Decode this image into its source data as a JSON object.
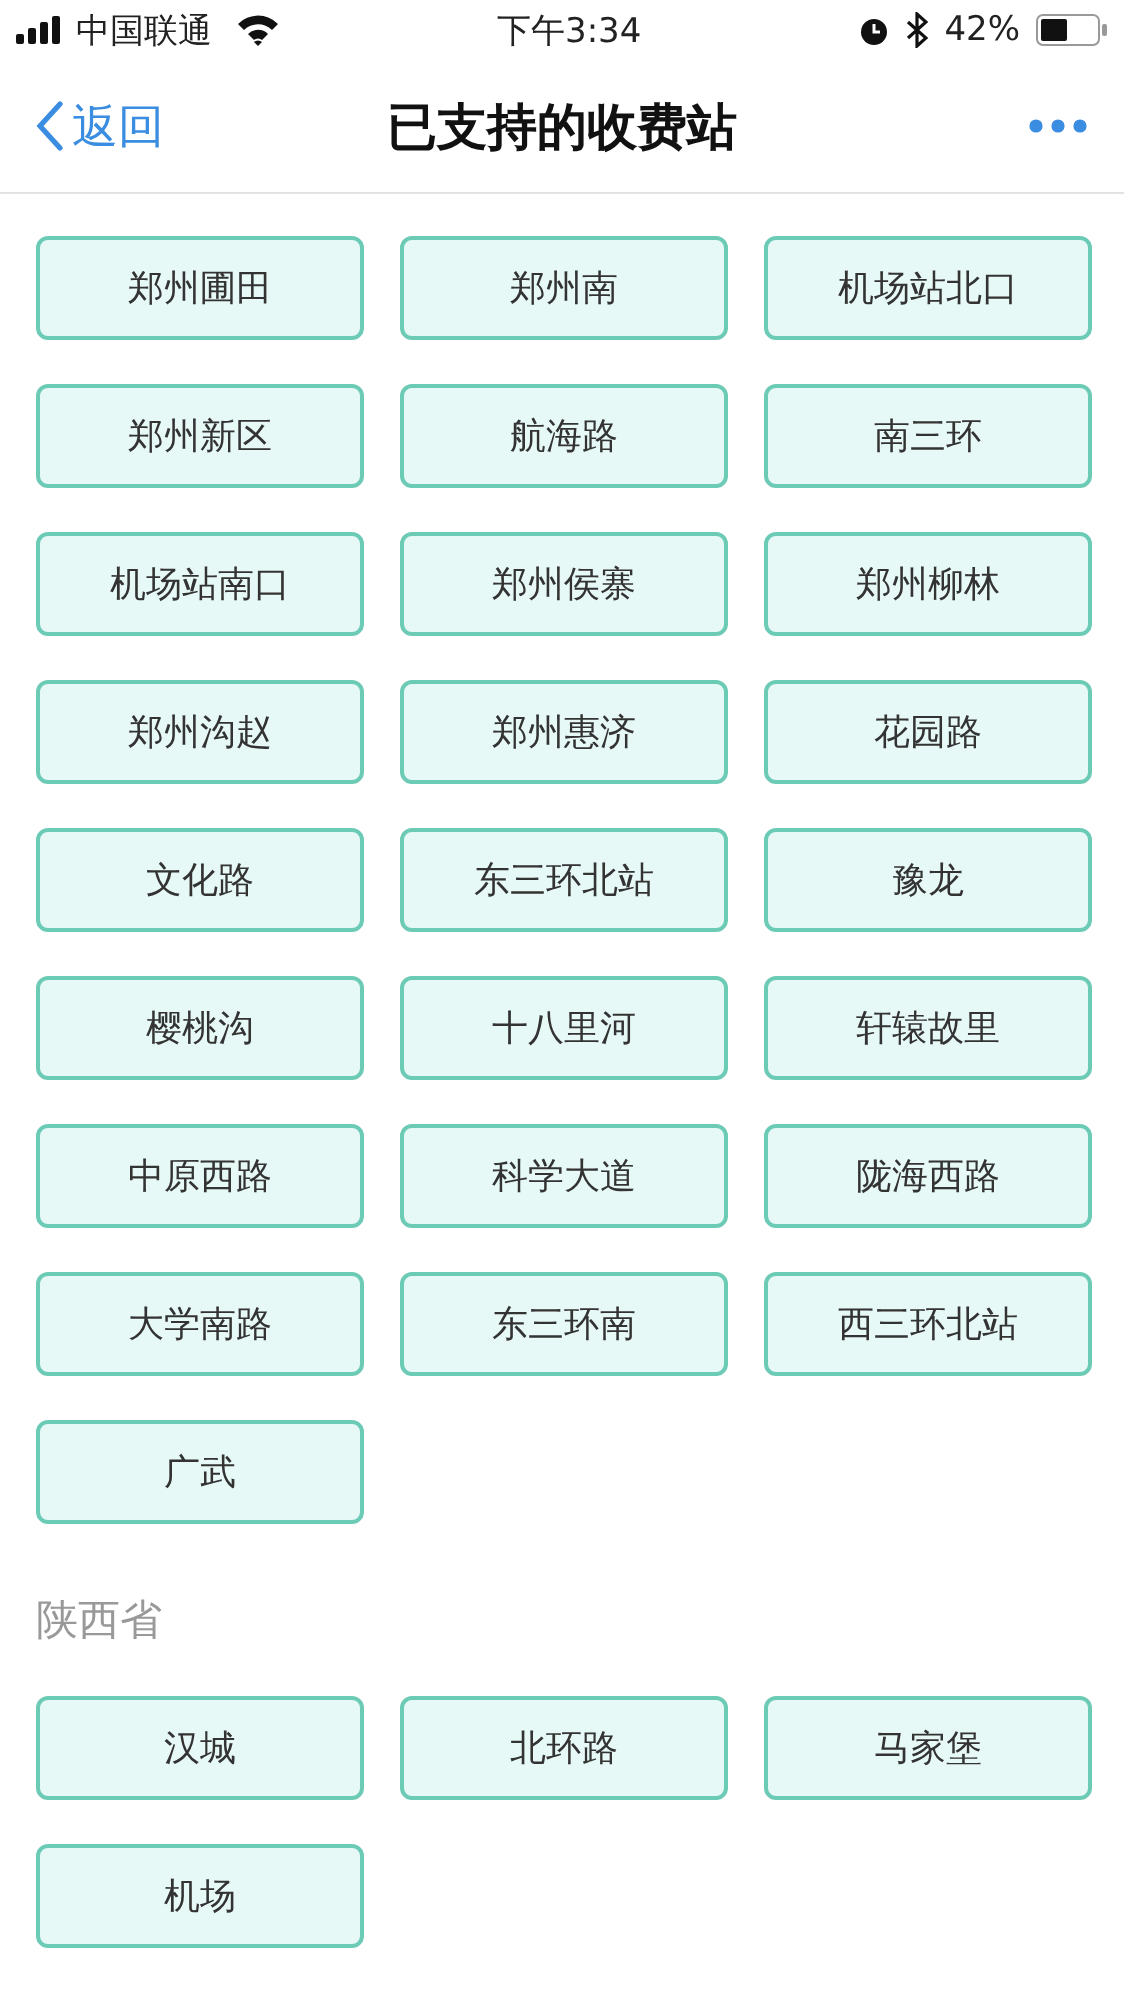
{
  "status_bar": {
    "carrier": "中国联通",
    "time": "下午3:34",
    "battery": "42%"
  },
  "nav": {
    "back": "返回",
    "title": "已支持的收费站"
  },
  "sections": [
    {
      "stations": [
        "郑州圃田",
        "郑州南",
        "机场站北口",
        "郑州新区",
        "航海路",
        "南三环",
        "机场站南口",
        "郑州侯寨",
        "郑州柳林",
        "郑州沟赵",
        "郑州惠济",
        "花园路",
        "文化路",
        "东三环北站",
        "豫龙",
        "樱桃沟",
        "十八里河",
        "轩辕故里",
        "中原西路",
        "科学大道",
        "陇海西路",
        "大学南路",
        "东三环南",
        "西三环北站",
        "广武"
      ]
    },
    {
      "title": "陕西省",
      "stations": [
        "汉城",
        "北环路",
        "马家堡",
        "机场"
      ]
    }
  ]
}
